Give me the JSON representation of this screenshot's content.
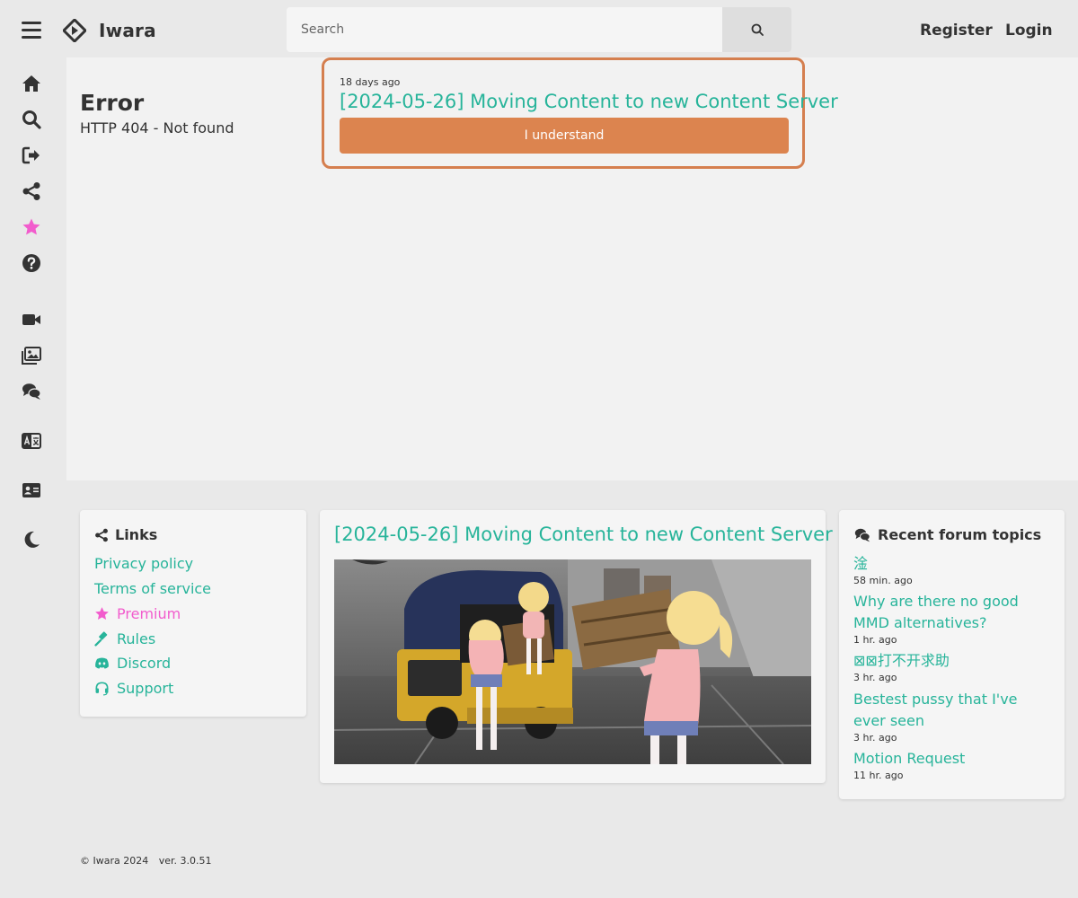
{
  "header": {
    "app_name": "Iwara",
    "search_placeholder": "Search",
    "register_label": "Register",
    "login_label": "Login"
  },
  "sidebar": {
    "icons": [
      "home-icon",
      "search-icon",
      "sign-out-icon",
      "share-icon",
      "star-icon",
      "help-icon",
      "video-icon",
      "images-icon",
      "comments-icon",
      "language-icon",
      "id-card-icon",
      "moon-icon"
    ]
  },
  "error": {
    "title": "Error",
    "message": "HTTP 404 - Not found"
  },
  "notice": {
    "date": "18 days ago",
    "title": "[2024-05-26] Moving Content to new Content Server",
    "button_label": "I understand"
  },
  "links": {
    "heading": "Links",
    "items": [
      {
        "label": "Privacy policy"
      },
      {
        "label": "Terms of service"
      },
      {
        "label": "Premium"
      },
      {
        "label": "Rules"
      },
      {
        "label": "Discord"
      },
      {
        "label": "Support"
      }
    ]
  },
  "post": {
    "title": "[2024-05-26] Moving Content to new Content Server"
  },
  "forum": {
    "heading": "Recent forum topics",
    "topics": [
      {
        "title": "淦",
        "time": "58 min. ago"
      },
      {
        "title": "Why are there no good MMD alternatives?",
        "time": "1 hr. ago"
      },
      {
        "title": "⊠⊠打不开求助",
        "time": "3 hr. ago"
      },
      {
        "title": "Bestest pussy that I've ever seen",
        "time": "3 hr. ago"
      },
      {
        "title": "Motion Request",
        "time": "11 hr. ago"
      }
    ]
  },
  "footer": {
    "copyright": "© Iwara 2024",
    "version": "ver. 3.0.51"
  },
  "colors": {
    "accent": "#27b49a",
    "notice_border": "#d57f4f",
    "button": "#dc844f",
    "premium": "#f25ccd"
  }
}
